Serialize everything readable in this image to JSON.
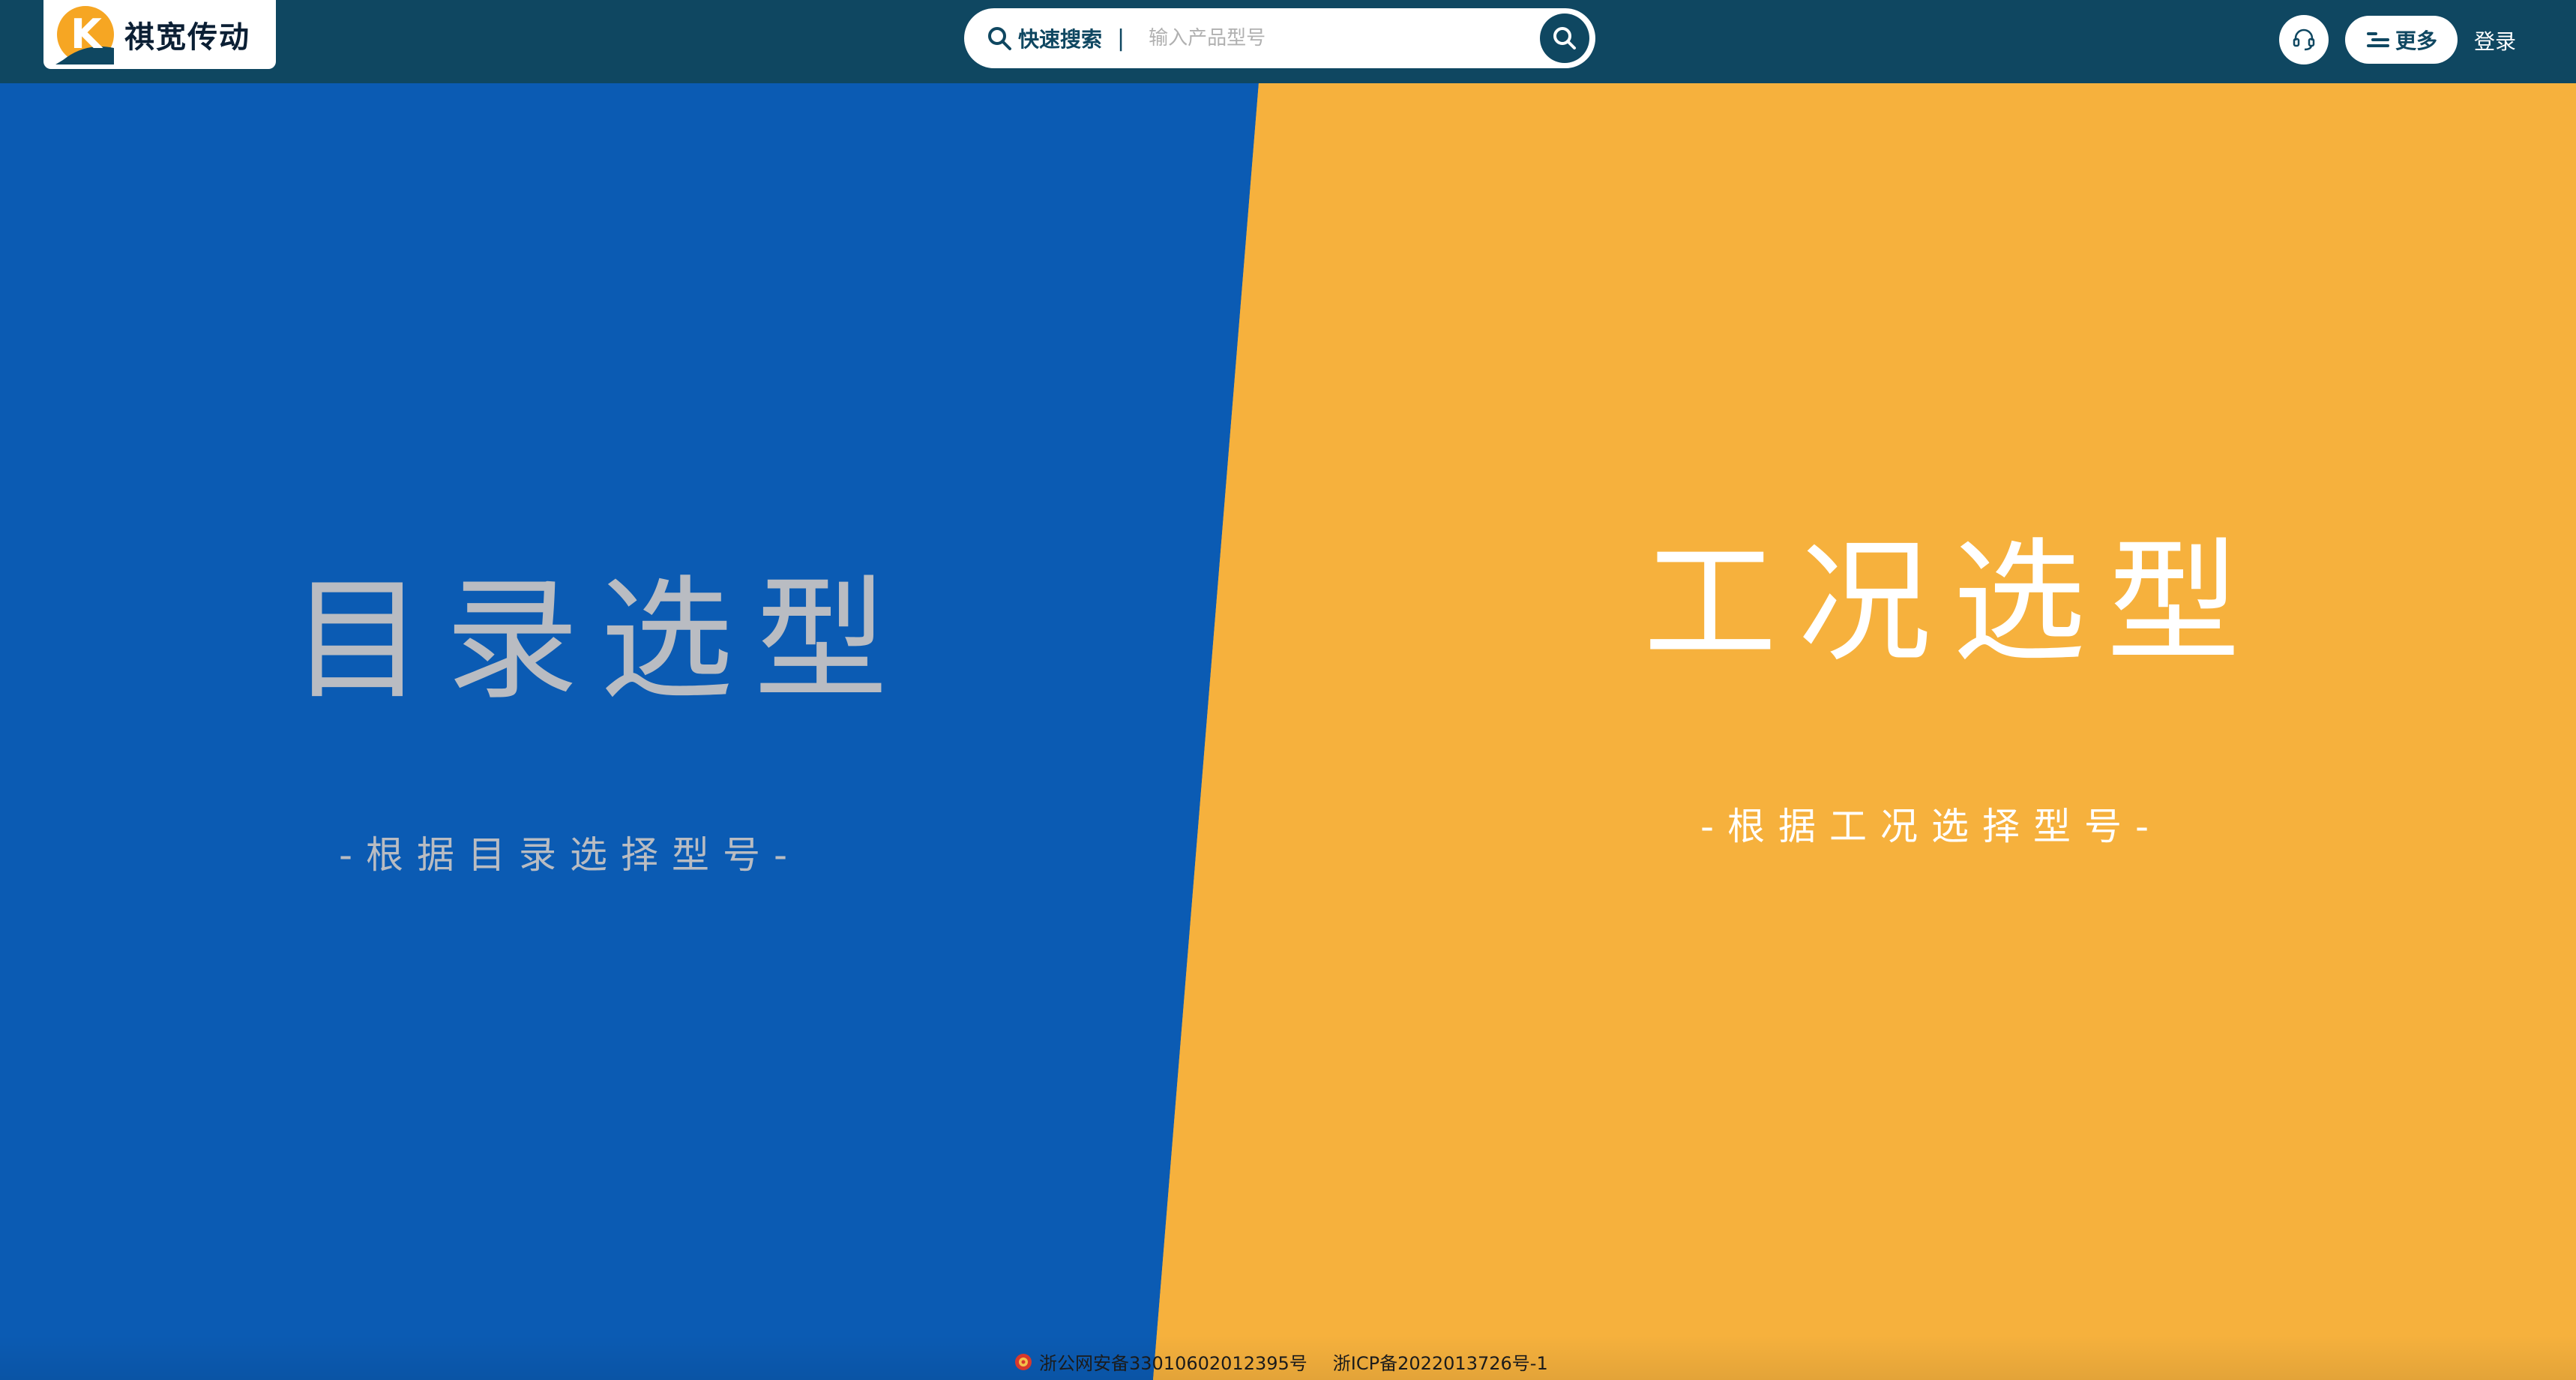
{
  "header": {
    "logo_text": "祺宽传动",
    "logo_letter": "K",
    "search": {
      "label": "快速搜索",
      "separator": "|",
      "placeholder": "输入产品型号",
      "value": ""
    },
    "more_label": "更多",
    "login_label": "登录"
  },
  "panels": {
    "left": {
      "title": "目录选型",
      "subtitle": "-根据目录选择型号-",
      "color": "#0b5bb3"
    },
    "right": {
      "title": "工况选型",
      "subtitle": "-根据工况选择型号-",
      "color": "#f6b13d"
    }
  },
  "footer": {
    "police_record": "浙公网安备33010602012395号",
    "icp_record": "浙ICP备2022013726号-1"
  },
  "colors": {
    "topbar": "#0f4761",
    "accent_orange": "#f6b13d",
    "accent_blue": "#0b5bb3"
  },
  "icons": {
    "search": "search-icon",
    "support": "headset-icon",
    "menu": "menu-icon",
    "police": "police-badge-icon"
  }
}
